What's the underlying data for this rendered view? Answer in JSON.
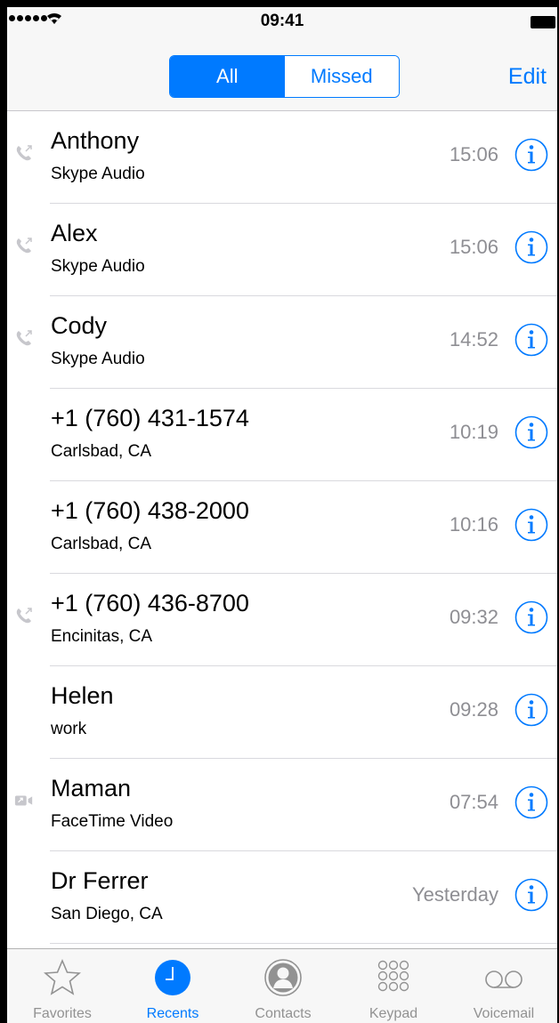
{
  "status_bar": {
    "time": "09:41"
  },
  "nav": {
    "segments": [
      {
        "label": "All",
        "active": true
      },
      {
        "label": "Missed",
        "active": false
      }
    ],
    "edit_label": "Edit"
  },
  "calls": [
    {
      "name": "Anthony",
      "subtitle": "Skype Audio",
      "time": "15:06",
      "icon": "phone-outgoing-icon"
    },
    {
      "name": "Alex",
      "subtitle": "Skype Audio",
      "time": "15:06",
      "icon": "phone-outgoing-icon"
    },
    {
      "name": "Cody",
      "subtitle": "Skype Audio",
      "time": "14:52",
      "icon": "phone-outgoing-icon"
    },
    {
      "name": "+1 (760) 431-1574",
      "subtitle": "Carlsbad, CA",
      "time": "10:19",
      "icon": ""
    },
    {
      "name": "+1 (760) 438-2000",
      "subtitle": "Carlsbad, CA",
      "time": "10:16",
      "icon": ""
    },
    {
      "name": "+1 (760) 436-8700",
      "subtitle": "Encinitas, CA",
      "time": "09:32",
      "icon": "phone-outgoing-icon"
    },
    {
      "name": "Helen",
      "subtitle": "work",
      "time": "09:28",
      "icon": ""
    },
    {
      "name": "Maman",
      "subtitle": "FaceTime Video",
      "time": "07:54",
      "icon": "video-outgoing-icon"
    },
    {
      "name": "Dr Ferrer",
      "subtitle": "San Diego, CA",
      "time": "Yesterday",
      "icon": ""
    }
  ],
  "tabs": [
    {
      "label": "Favorites",
      "icon": "star-icon",
      "active": false
    },
    {
      "label": "Recents",
      "icon": "clock-icon",
      "active": true
    },
    {
      "label": "Contacts",
      "icon": "person-icon",
      "active": false
    },
    {
      "label": "Keypad",
      "icon": "keypad-icon",
      "active": false
    },
    {
      "label": "Voicemail",
      "icon": "voicemail-icon",
      "active": false
    }
  ],
  "colors": {
    "accent": "#007aff",
    "secondary_text": "#8e8e93",
    "bar_bg": "#f7f7f7"
  }
}
